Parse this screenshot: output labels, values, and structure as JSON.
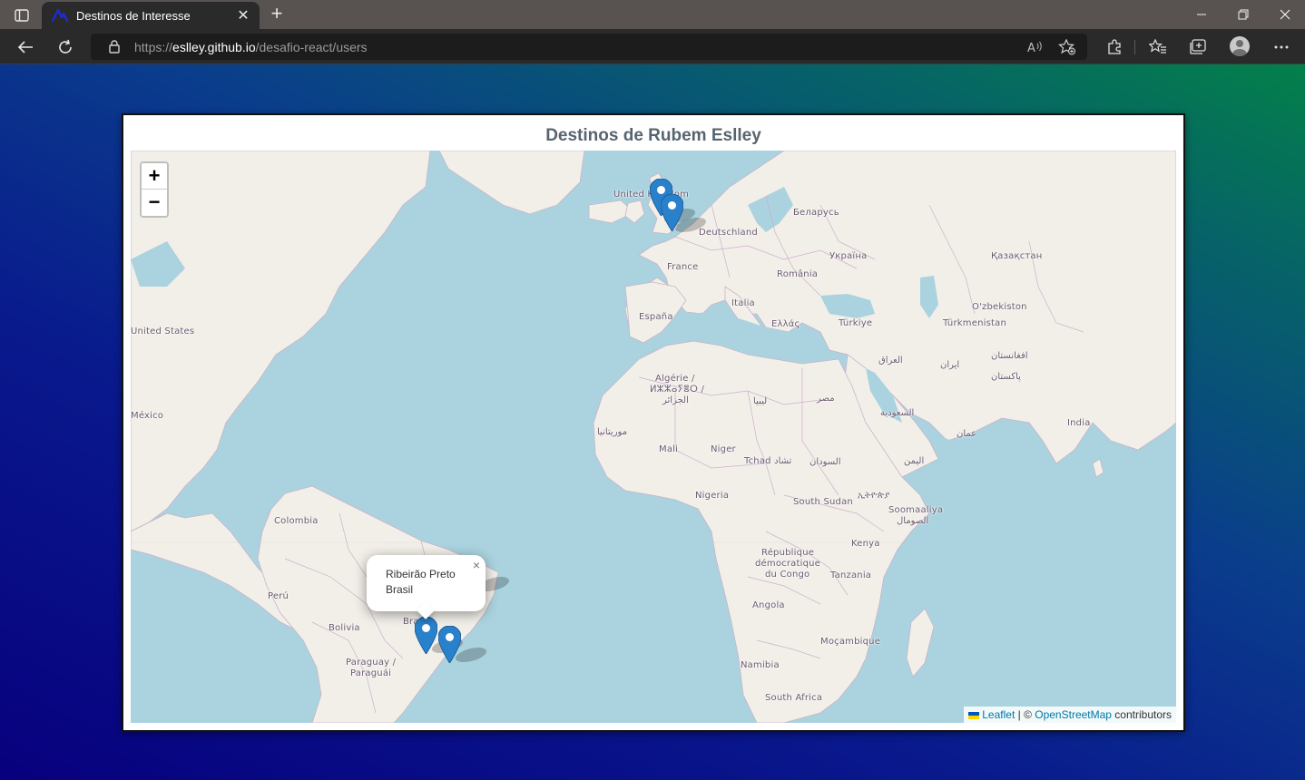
{
  "browser": {
    "tab_title": "Destinos de Interesse",
    "url_scheme": "https://",
    "url_host": "eslley.github.io",
    "url_path": "/desafio-react/users"
  },
  "page": {
    "title": "Destinos de Rubem Eslley"
  },
  "map": {
    "zoom_in_label": "+",
    "zoom_out_label": "−",
    "labels": {
      "united_kingdom": "United Kingdom",
      "deutschland": "Deutschland",
      "belarus": "Беларусь",
      "ukraine": "Україна",
      "kazakhstan": "Қазақстан",
      "france": "France",
      "romania": "România",
      "uzbekistan": "O'zbekiston",
      "turkmenistan": "Türkmenistan",
      "italia": "Italia",
      "espana": "España",
      "ellada": "Ελλάς",
      "turkiye": "Türkiye",
      "united_states": "United States",
      "algerie_1": "Algérie /",
      "algerie_2": "ⵍⵣⵣⴰⵢⴻⵔ /",
      "algerie_3": "الجزائر",
      "libya": "ليبيا",
      "egypt": "مصر",
      "iraq": "العراق",
      "iran": "ایران",
      "afghanistan": "افغانستان",
      "pakistan": "پاکستان",
      "mexico": "México",
      "mauritania": "موريتانيا",
      "saudi": "السعودية",
      "india": "India",
      "oman": "عمان",
      "mali": "Mali",
      "niger": "Niger",
      "tchad": "Tchad تشاد",
      "sudan": "السودان",
      "yemen": "اليمن",
      "nigeria": "Nigeria",
      "south_sudan": "South Sudan",
      "ethiopia": "ኢትዮጵያ",
      "colombia": "Colombia",
      "somaliland_1": "Soomaaliya",
      "somaliland_2": "الصومال",
      "kenya": "Kenya",
      "rdc_1": "République",
      "rdc_2": "démocratique",
      "rdc_3": "du Congo",
      "tanzania": "Tanzania",
      "peru": "Perú",
      "angola": "Angola",
      "bolivia": "Bolivia",
      "brasil": "Brasil",
      "mozambique": "Moçambique",
      "paraguay_1": "Paraguay /",
      "paraguay_2": "Paraguái",
      "namibia": "Namibia",
      "south_africa": "South Africa"
    },
    "popup": {
      "line1": "Ribeirão Preto",
      "line2": "Brasil",
      "close": "×"
    },
    "attribution": {
      "leaflet": "Leaflet",
      "sep": " | © ",
      "osm": "OpenStreetMap",
      "rest": " contributors"
    }
  }
}
